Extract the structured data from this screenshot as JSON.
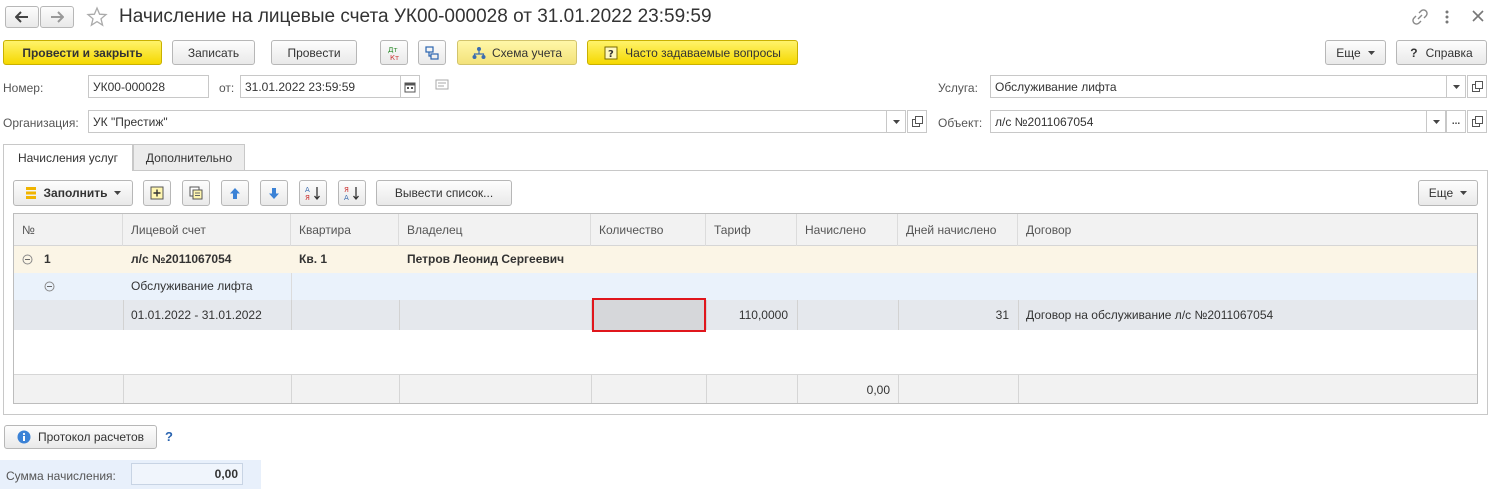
{
  "window": {
    "title": "Начисление на лицевые счета УК00-000028 от 31.01.2022 23:59:59"
  },
  "toolbar": {
    "post_close": "Провести и закрыть",
    "save": "Записать",
    "post": "Провести",
    "scheme": "Схема учета",
    "faq": "Часто задаваемые вопросы",
    "more": "Еще",
    "help": "Справка"
  },
  "header": {
    "number_label": "Номер:",
    "number_value": "УК00-000028",
    "date_label": "от:",
    "date_value": "31.01.2022 23:59:59",
    "org_label": "Организация:",
    "org_value": "УК \"Престиж\"",
    "service_label": "Услуга:",
    "service_value": "Обслуживание лифта",
    "object_label": "Объект:",
    "object_value": "л/с №2011067054"
  },
  "tabs": [
    {
      "label": "Начисления услуг"
    },
    {
      "label": "Дополнительно"
    }
  ],
  "table_toolbar": {
    "fill": "Заполнить",
    "output_list": "Вывести список...",
    "more": "Еще"
  },
  "table": {
    "columns": [
      "№",
      "Лицевой счет",
      "Квартира",
      "Владелец",
      "Количество",
      "Тариф",
      "Начислено",
      "Дней начислено",
      "Договор"
    ],
    "group_row": {
      "num": "1",
      "account": "л/с №2011067054",
      "apartment": "Кв. 1",
      "owner": "Петров Леонид Сергеевич"
    },
    "service_row": {
      "service": "Обслуживание лифта"
    },
    "detail_row": {
      "period": "01.01.2022 - 31.01.2022",
      "quantity": "",
      "tariff": "110,0000",
      "accrued": "",
      "days": "31",
      "contract": "Договор на обслуживание л/с №2011067054"
    },
    "footer": {
      "accrued_total": "0,00"
    }
  },
  "bottom": {
    "protocol": "Протокол расчетов",
    "question": "?",
    "sum_label": "Сумма начисления:",
    "sum_value": "0,00"
  }
}
